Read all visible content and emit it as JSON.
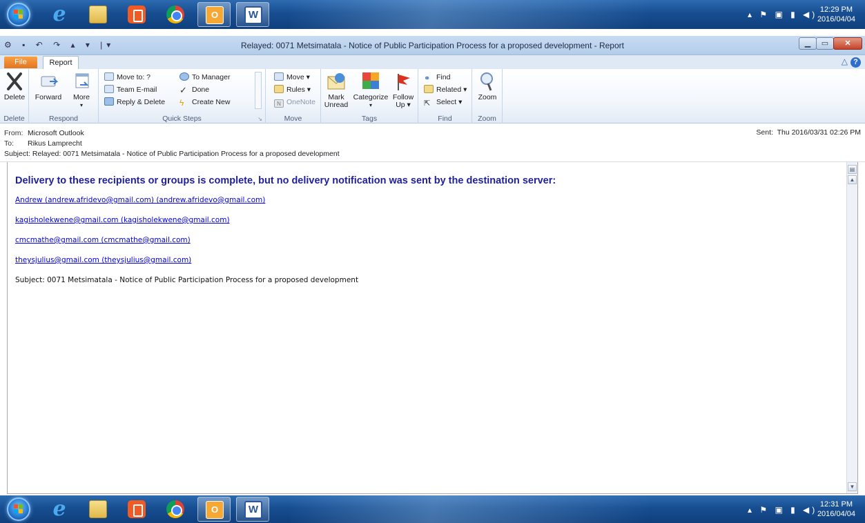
{
  "taskbar_top": {
    "clock_time": "12:29 PM",
    "clock_date": "2016/04/04",
    "apps": [
      "start-orb",
      "ie-icon",
      "explorer-icon",
      "media-player-icon",
      "chrome-icon",
      "outlook-icon",
      "word-icon"
    ]
  },
  "taskbar_bottom": {
    "clock_time": "12:31 PM",
    "clock_date": "2016/04/04"
  },
  "window": {
    "title": "Relayed: 0071 Metsimatala - Notice of Public Participation Process for a proposed development  -  Report"
  },
  "tabs": {
    "file": "File",
    "report": "Report"
  },
  "ribbon": {
    "delete_group": {
      "delete": "Delete",
      "label": "Delete"
    },
    "respond_group": {
      "forward": "Forward",
      "more": "More",
      "label": "Respond"
    },
    "quick_steps": {
      "move_to": "Move to: ?",
      "team_email": "Team E-mail",
      "reply_delete": "Reply & Delete",
      "to_manager": "To Manager",
      "done": "Done",
      "create_new": "Create New",
      "label": "Quick Steps"
    },
    "move_group": {
      "move": "Move ▾",
      "rules": "Rules ▾",
      "onenote": "OneNote",
      "label": "Move"
    },
    "tags_group": {
      "mark_unread_1": "Mark",
      "mark_unread_2": "Unread",
      "categorize": "Categorize",
      "follow_up_1": "Follow",
      "follow_up_2": "Up ▾",
      "label": "Tags"
    },
    "find_group": {
      "find": "Find",
      "related": "Related ▾",
      "select": "Select ▾",
      "label": "Find"
    },
    "zoom_group": {
      "zoom": "Zoom",
      "label": "Zoom"
    }
  },
  "headers": {
    "from_label": "From:",
    "from_value": "Microsoft Outlook",
    "to_label": "To:",
    "to_value": "Rikus Lamprecht",
    "subject_label": "Subject:",
    "subject_value": "Relayed: 0071 Metsimatala - Notice of Public Participation Process for a proposed development",
    "sent_label": "Sent:",
    "sent_value": "Thu 2016/03/31 02:26 PM"
  },
  "message": {
    "heading": "Delivery to these recipients or groups is complete, but no delivery notification was sent by the destination server:",
    "recipients": [
      "Andrew (andrew.afridevo@gmail.com) (andrew.afridevo@gmail.com)",
      "kagisholekwene@gmail.com (kagisholekwene@gmail.com)",
      "cmcmathe@gmail.com (cmcmathe@gmail.com)",
      "theysjulius@gmail.com (theysjulius@gmail.com)"
    ],
    "subject_line": "Subject: 0071 Metsimatala - Notice of Public Participation Process for a proposed development"
  }
}
